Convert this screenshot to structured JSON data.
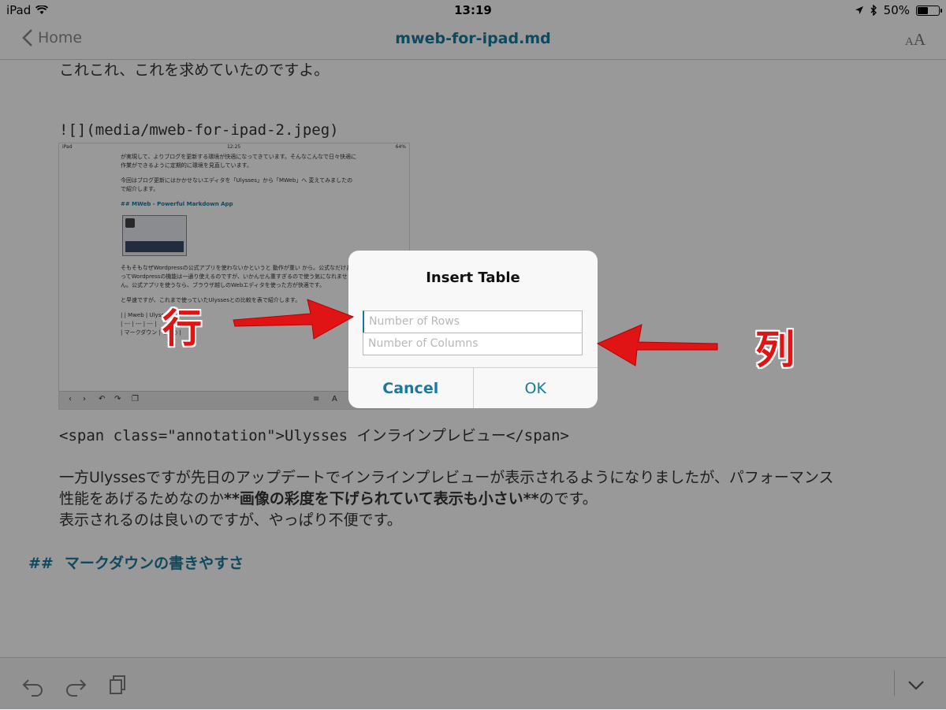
{
  "status_bar": {
    "device": "iPad",
    "time": "13:19",
    "battery": "50%",
    "battery_level": 0.5
  },
  "nav": {
    "back_label": "Home",
    "title": "mweb-for-ipad.md"
  },
  "editor": {
    "line1": "これこれ、これを求めていたのですよ。",
    "image_markdown": "![](media/mweb-for-ipad-2.jpeg)",
    "span_line": "<span class=\"annotation\">Ulysses インラインプレビュー</span>",
    "para1_line1": "一方Ulyssesですが先日のアップデートでインラインプレビューが表示されるようになりましたが、パフォーマンス",
    "para1_line2_pre": "性能をあげるためなのか",
    "para1_line2_bold": "**画像の彩度を下げられていて表示も小さい**",
    "para1_line2_post": "のです。",
    "para1_line3": "表示されるのは良いのですが、やっぱり不便です。",
    "heading_hash": "##",
    "heading_text": "マークダウンの書きやすさ"
  },
  "embedded_image": {
    "status_device": "iPad",
    "status_time": "12:25",
    "status_battery": "64%",
    "text1": "が実現して、よりブログを更新する環境が快適になってきています。そんなこんなで日々快適に作業ができるように定期的に環境を見直しています。",
    "text2": "今回はブログ更新にはかかせないエディタを「Ulysses」から「MWeb」へ 変えてみましたので紹介します。",
    "heading": "## MWeb - Powerful Markdown App",
    "text3": "そもそもなぜWordpressの公式アプリを使わないかというと 動作が重い から。公式なだけあってWordpressの機能は一通り使えるのですが、いかんせん重すぎるので使う気になれません。公式アプリを使うなら、ブラウザ越しのWebエディタを使った方が快適です。",
    "text4": "と早速ですが、これまで使っていたUlyssesとの比較を表で紹介します。",
    "table1": "| | Mweb | Ulysses |",
    "table2": "| --- | --- | --- |",
    "table3": "| マークダウン | ○ | ○ |"
  },
  "dialog": {
    "title": "Insert Table",
    "rows_placeholder": "Number of Rows",
    "columns_placeholder": "Number of Columns",
    "cancel_label": "Cancel",
    "ok_label": "OK"
  },
  "annotations": {
    "rows_label": "行",
    "columns_label": "列",
    "arrow_color": "#e01414"
  },
  "colors": {
    "accent": "#1a7a9c",
    "overlay": "rgba(0,0,0,0.40)"
  }
}
